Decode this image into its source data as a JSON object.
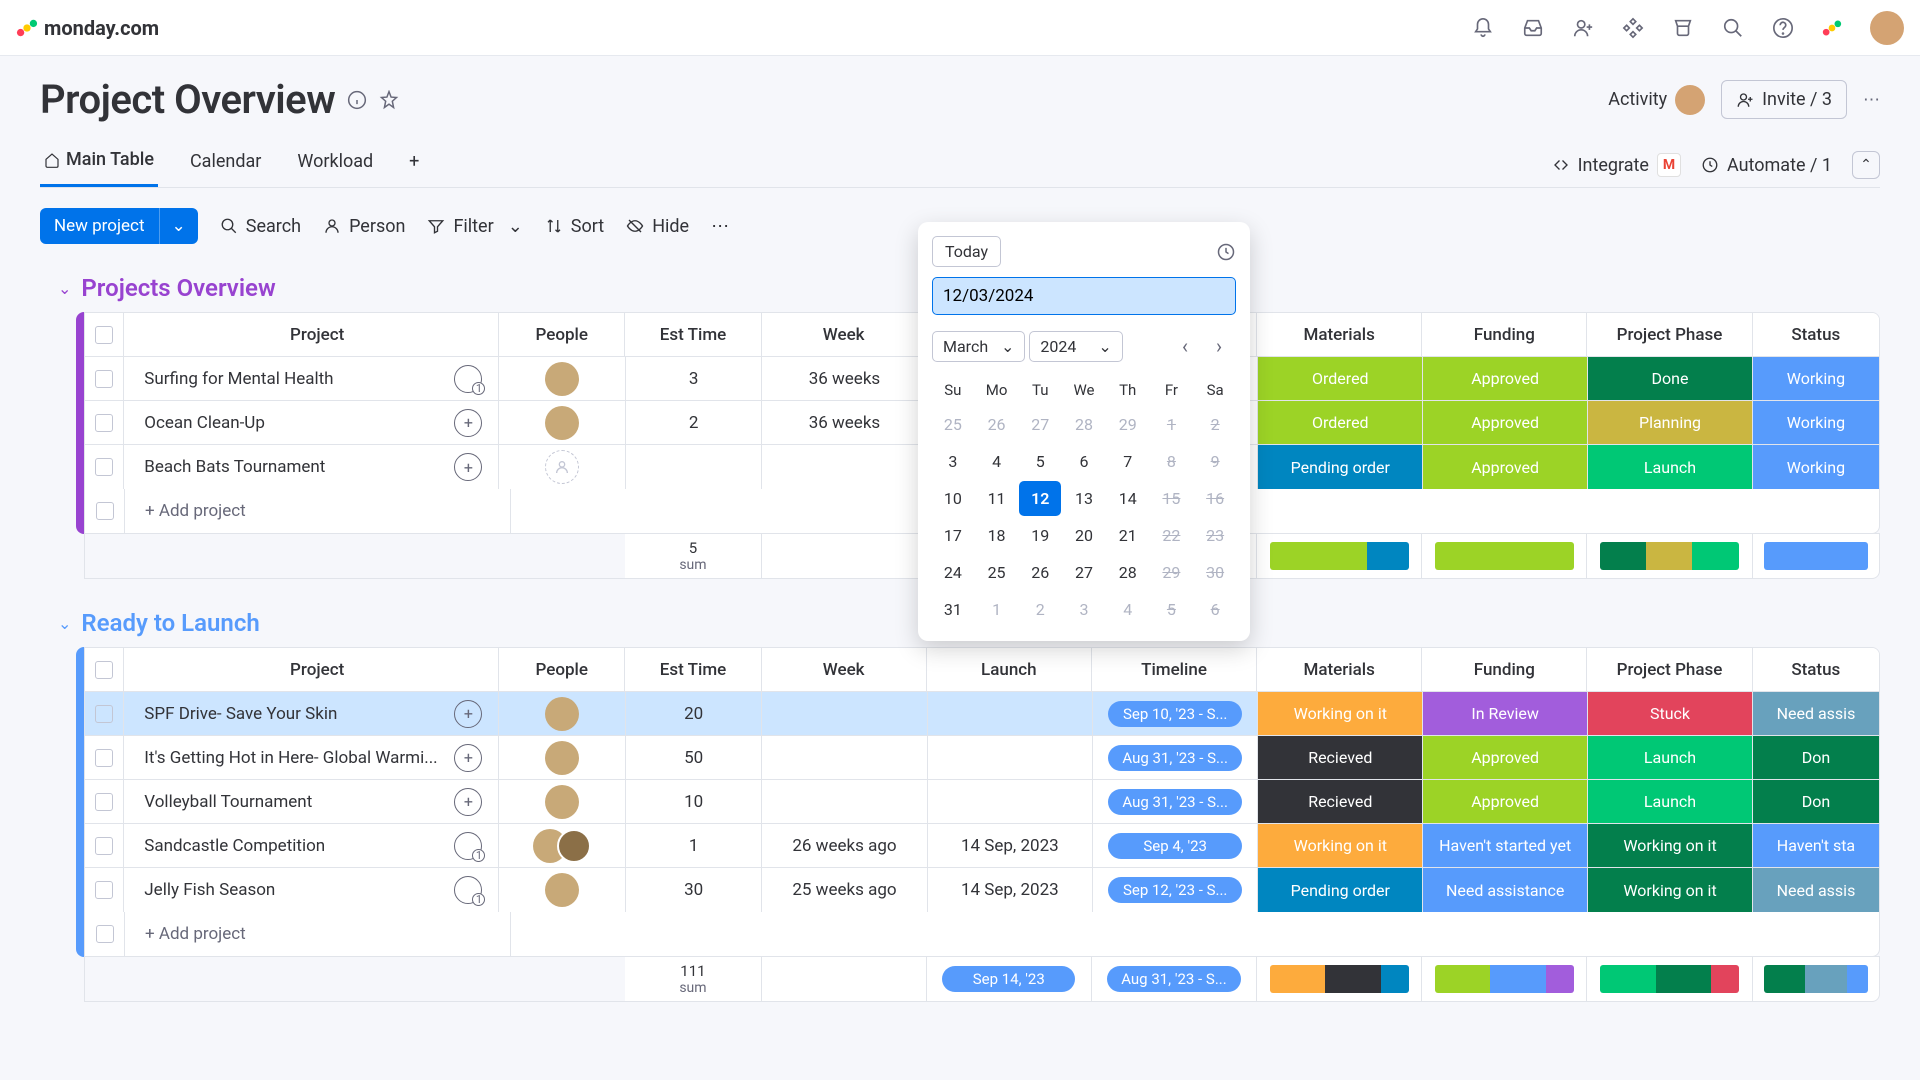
{
  "brand": "monday.com",
  "page_title": "Project Overview",
  "activity_label": "Activity",
  "invite_label": "Invite / 3",
  "tabs": {
    "main": "Main Table",
    "calendar": "Calendar",
    "workload": "Workload"
  },
  "integrate_label": "Integrate",
  "automate_label": "Automate / 1",
  "toolbar": {
    "new_project": "New project",
    "search": "Search",
    "person": "Person",
    "filter": "Filter",
    "sort": "Sort",
    "hide": "Hide"
  },
  "columns": {
    "project": "Project",
    "people": "People",
    "est": "Est Time",
    "week": "Week",
    "launch": "Launch",
    "timeline": "Timeline",
    "materials": "Materials",
    "funding": "Funding",
    "phase": "Project Phase",
    "status": "Status"
  },
  "groups": [
    {
      "name": "Projects Overview",
      "color": "#9843d0",
      "rows": [
        {
          "project": "Surfing for Mental Health",
          "conv": "1",
          "people": "avatar",
          "est": "3",
          "week": "36 weeks",
          "timeline": "pill",
          "materials": {
            "t": "Ordered",
            "c": "#9cd326"
          },
          "funding": {
            "t": "Approved",
            "c": "#9cd326"
          },
          "phase": {
            "t": "Done",
            "c": "#037f4c"
          },
          "status": {
            "t": "Working",
            "c": "#579bfc"
          }
        },
        {
          "project": "Ocean Clean-Up",
          "conv": "+",
          "people": "avatar",
          "est": "2",
          "week": "36 weeks",
          "timeline": "pill",
          "materials": {
            "t": "Ordered",
            "c": "#9cd326"
          },
          "funding": {
            "t": "Approved",
            "c": "#9cd326"
          },
          "phase": {
            "t": "Planning",
            "c": "#cab641"
          },
          "status": {
            "t": "Working",
            "c": "#579bfc"
          }
        },
        {
          "project": "Beach Bats Tournament",
          "conv": "+",
          "people": "empty",
          "est": "",
          "week": "",
          "timeline": "pill",
          "materials": {
            "t": "Pending order",
            "c": "#0086c0"
          },
          "funding": {
            "t": "Approved",
            "c": "#9cd326"
          },
          "phase": {
            "t": "Launch",
            "c": "#00c875"
          },
          "status": {
            "t": "Working",
            "c": "#579bfc"
          }
        }
      ],
      "add_label": "+ Add project",
      "sum": {
        "est": "5",
        "lbl": "sum"
      }
    },
    {
      "name": "Ready to Launch",
      "color": "#579bfc",
      "rows": [
        {
          "project": "SPF Drive- Save Your Skin",
          "selected": true,
          "conv": "+",
          "people": "avatar",
          "est": "20",
          "week": "",
          "launch": "",
          "timeline": {
            "t": "Sep 10, '23 - S..."
          },
          "materials": {
            "t": "Working on it",
            "c": "#fdab3d"
          },
          "funding": {
            "t": "In Review",
            "c": "#a25ddc"
          },
          "phase": {
            "t": "Stuck",
            "c": "#e2445c"
          },
          "status": {
            "t": "Need assis",
            "c": "#68a1bd"
          }
        },
        {
          "project": "It's Getting Hot in Here- Global Warmi...",
          "conv": "+",
          "people": "avatar",
          "est": "50",
          "week": "",
          "launch": "",
          "timeline": {
            "t": "Aug 31, '23 - S..."
          },
          "materials": {
            "t": "Recieved",
            "c": "#323338"
          },
          "funding": {
            "t": "Approved",
            "c": "#9cd326"
          },
          "phase": {
            "t": "Launch",
            "c": "#00c875"
          },
          "status": {
            "t": "Don",
            "c": "#037f4c"
          }
        },
        {
          "project": "Volleyball Tournament",
          "conv": "+",
          "people": "avatar",
          "est": "10",
          "week": "",
          "launch": "",
          "timeline": {
            "t": "Aug 31, '23 - S..."
          },
          "materials": {
            "t": "Recieved",
            "c": "#323338"
          },
          "funding": {
            "t": "Approved",
            "c": "#9cd326"
          },
          "phase": {
            "t": "Launch",
            "c": "#00c875"
          },
          "status": {
            "t": "Don",
            "c": "#037f4c"
          }
        },
        {
          "project": "Sandcastle Competition",
          "conv": "1",
          "people": "stack",
          "est": "1",
          "week": "26 weeks ago",
          "launch": "14 Sep, 2023",
          "timeline": {
            "t": "Sep 4, '23"
          },
          "materials": {
            "t": "Working on it",
            "c": "#fdab3d"
          },
          "funding": {
            "t": "Haven't started yet",
            "c": "#579bfc"
          },
          "phase": {
            "t": "Working on it",
            "c": "#037f4c"
          },
          "status": {
            "t": "Haven't sta",
            "c": "#579bfc"
          }
        },
        {
          "project": "Jelly Fish Season",
          "conv": "1",
          "people": "avatar",
          "est": "30",
          "week": "25 weeks ago",
          "launch": "14 Sep, 2023",
          "timeline": {
            "t": "Sep 12, '23 - S..."
          },
          "materials": {
            "t": "Pending order",
            "c": "#0086c0"
          },
          "funding": {
            "t": "Need assistance",
            "c": "#579bfc"
          },
          "phase": {
            "t": "Working on it",
            "c": "#037f4c"
          },
          "status": {
            "t": "Need assis",
            "c": "#68a1bd"
          }
        }
      ],
      "add_label": "+ Add project",
      "sum": {
        "est": "111",
        "lbl": "sum",
        "launch_pill": "Sep 14, '23",
        "timeline_pill": "Aug 31, '23 - S..."
      }
    }
  ],
  "summary_bars": {
    "g1": {
      "materials": [
        [
          "#9cd326",
          70
        ],
        [
          "#0086c0",
          30
        ]
      ],
      "funding": [
        [
          "#9cd326",
          100
        ]
      ],
      "phase": [
        [
          "#037f4c",
          33
        ],
        [
          "#cab641",
          33
        ],
        [
          "#00c875",
          34
        ]
      ],
      "status": [
        [
          "#579bfc",
          100
        ]
      ]
    },
    "g2": {
      "materials": [
        [
          "#fdab3d",
          40
        ],
        [
          "#323338",
          40
        ],
        [
          "#0086c0",
          20
        ]
      ],
      "funding": [
        [
          "#9cd326",
          40
        ],
        [
          "#579bfc",
          40
        ],
        [
          "#a25ddc",
          20
        ]
      ],
      "phase": [
        [
          "#00c875",
          40
        ],
        [
          "#037f4c",
          40
        ],
        [
          "#e2445c",
          20
        ]
      ],
      "status": [
        [
          "#037f4c",
          40
        ],
        [
          "#68a1bd",
          40
        ],
        [
          "#579bfc",
          20
        ]
      ]
    }
  },
  "datepicker": {
    "today": "Today",
    "input": "12/03/2024",
    "month": "March",
    "year": "2024",
    "dow": [
      "Su",
      "Mo",
      "Tu",
      "We",
      "Th",
      "Fr",
      "Sa"
    ],
    "weeks": [
      [
        {
          "d": "25",
          "m": 1
        },
        {
          "d": "26",
          "m": 1
        },
        {
          "d": "27",
          "m": 1
        },
        {
          "d": "28",
          "m": 1
        },
        {
          "d": "29",
          "m": 1
        },
        {
          "d": "1",
          "s": 1
        },
        {
          "d": "2",
          "s": 1
        }
      ],
      [
        {
          "d": "3"
        },
        {
          "d": "4"
        },
        {
          "d": "5"
        },
        {
          "d": "6"
        },
        {
          "d": "7"
        },
        {
          "d": "8",
          "s": 1
        },
        {
          "d": "9",
          "s": 1
        }
      ],
      [
        {
          "d": "10"
        },
        {
          "d": "11"
        },
        {
          "d": "12",
          "t": 1
        },
        {
          "d": "13"
        },
        {
          "d": "14"
        },
        {
          "d": "15",
          "s": 1
        },
        {
          "d": "16",
          "s": 1
        }
      ],
      [
        {
          "d": "17"
        },
        {
          "d": "18"
        },
        {
          "d": "19"
        },
        {
          "d": "20"
        },
        {
          "d": "21"
        },
        {
          "d": "22",
          "s": 1
        },
        {
          "d": "23",
          "s": 1
        }
      ],
      [
        {
          "d": "24"
        },
        {
          "d": "25"
        },
        {
          "d": "26"
        },
        {
          "d": "27"
        },
        {
          "d": "28"
        },
        {
          "d": "29",
          "s": 1
        },
        {
          "d": "30",
          "s": 1
        }
      ],
      [
        {
          "d": "31"
        },
        {
          "d": "1",
          "m": 1
        },
        {
          "d": "2",
          "m": 1
        },
        {
          "d": "3",
          "m": 1
        },
        {
          "d": "4",
          "m": 1
        },
        {
          "d": "5",
          "s": 1
        },
        {
          "d": "6",
          "s": 1
        }
      ]
    ]
  }
}
